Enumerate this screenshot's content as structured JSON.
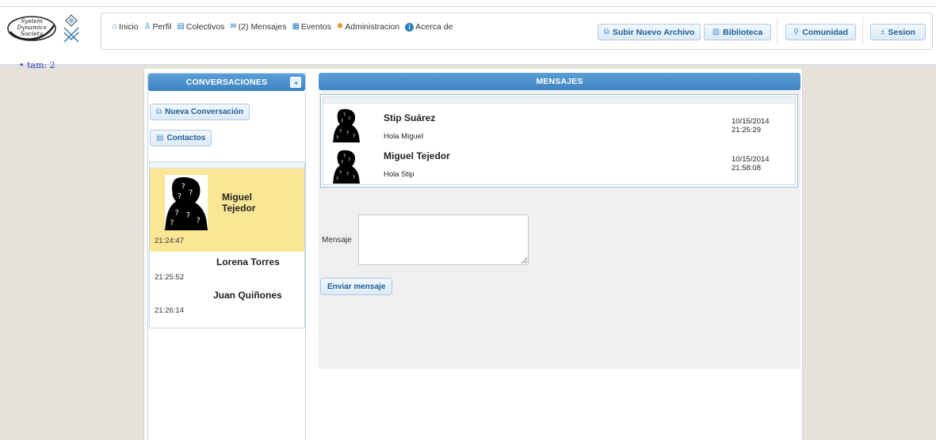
{
  "header": {
    "logo_text": [
      "System",
      "Dynamics",
      "Society"
    ],
    "nav": [
      {
        "icon": "home-icon",
        "glyph": "⌂",
        "label": "Inicio"
      },
      {
        "icon": "user-icon",
        "glyph": "♙",
        "label": "Perfil"
      },
      {
        "icon": "group-icon",
        "glyph": "▤",
        "label": "Colectivos"
      },
      {
        "icon": "mail-icon",
        "glyph": "✉",
        "label": "(2) Mensajes"
      },
      {
        "icon": "calendar-icon",
        "glyph": "▦",
        "label": "Eventos"
      },
      {
        "icon": "gear-icon",
        "glyph": "✱",
        "label": "Administracion"
      },
      {
        "icon": "info-icon",
        "glyph": "i",
        "label": "Acerca de"
      }
    ],
    "buttons": {
      "upload": "Subir Nuevo Archivo",
      "library": "Biblioteca",
      "community": "Comunidad",
      "session": "Sesion"
    },
    "stray_text": "• tam: 2"
  },
  "left": {
    "title": "CONVERSACIONES",
    "new_conversation": "Nueva Conversación",
    "contacts": "Contactos",
    "conversations": [
      {
        "name_line1": "Miguel",
        "name_line2": "Tejedor",
        "time": "21:24:47"
      },
      {
        "name": "Lorena Torres",
        "time": "21:25:52"
      },
      {
        "name": "Juan Quiñones",
        "time": "21:26:14"
      }
    ]
  },
  "right": {
    "title": "MENSAJES",
    "messages": [
      {
        "sender": "Stip Suárez",
        "text": "Hola Miguel",
        "date": "10/15/2014",
        "time": "21:25:29"
      },
      {
        "sender": "Miguel Tejedor",
        "text": "Hola Stip",
        "date": "10/15/2014",
        "time": "21:58:08"
      }
    ],
    "compose_label": "Mensaje",
    "compose_value": "",
    "send_label": "Enviar mensaje"
  },
  "colors": {
    "accent": "#3f84c2",
    "active_row": "#fae694",
    "background": "#e6e2da"
  }
}
